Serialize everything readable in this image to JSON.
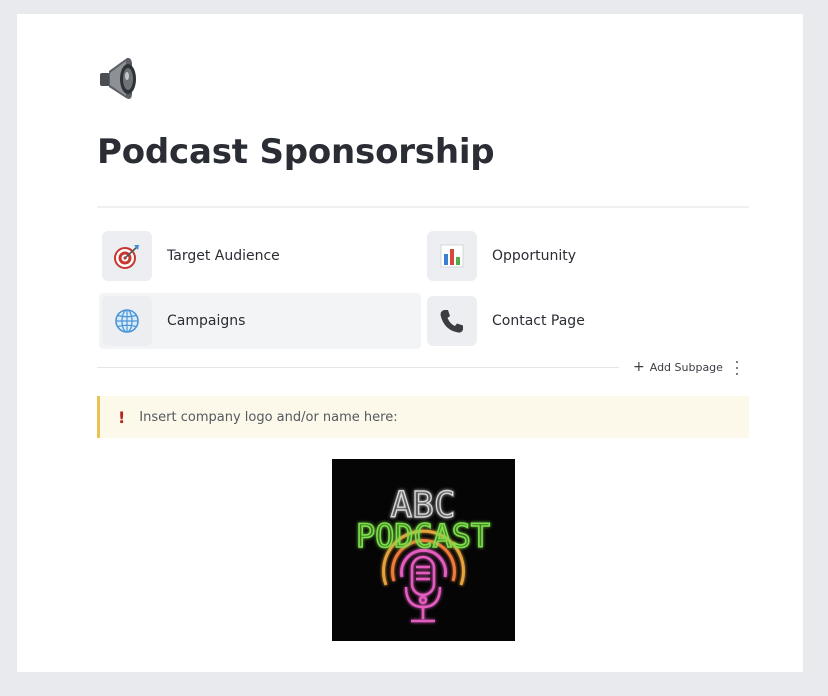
{
  "page": {
    "icon": "speaker-icon",
    "title": "Podcast Sponsorship"
  },
  "subpages": [
    {
      "label": "Target Audience",
      "icon": "target-icon"
    },
    {
      "label": "Opportunity",
      "icon": "bar-chart-icon"
    },
    {
      "label": "Campaigns",
      "icon": "globe-icon"
    },
    {
      "label": "Contact Page",
      "icon": "phone-icon"
    }
  ],
  "add_subpage_label": "Add Subpage",
  "callout": {
    "icon": "exclamation-icon",
    "text": "Insert company logo and/or name here:"
  },
  "logo": {
    "line1": "ABC",
    "line2": "PODCAST"
  },
  "colors": {
    "callout_bg": "#fcf8ea",
    "callout_border": "#e8c254",
    "callout_icon": "#b3261e",
    "logo_green": "#7be04a",
    "logo_pink": "#e45cbf"
  }
}
